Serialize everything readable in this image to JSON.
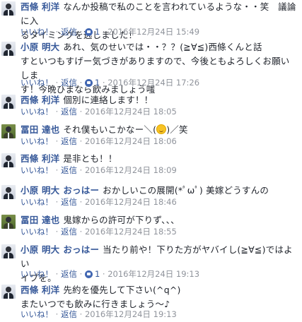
{
  "actions": {
    "like": "いいね！",
    "reply": "返信",
    "dot": "·"
  },
  "comments": [
    {
      "author": "西條 利洋",
      "line1": "なんか投稿で私のことを言われているような・・笑　議論に入",
      "line2": "るタイミングを逃しました！",
      "likes": "1",
      "date": "2016年12月24日 15:49"
    },
    {
      "author": "小原 明大",
      "line1": "あれ、気のせいでは・・？？(≧∀≦)西條くんと話",
      "line2": "すといつもすげー気づきがありますので、今後ともよろしくお願いしま",
      "line3": "す！今晩ひまなら飲みましょう嗤",
      "likes": "1",
      "date": "2016年12月24日 17:26"
    },
    {
      "author": "西條 利洋",
      "line1": "個別に連絡します！！",
      "date": "2016年12月24日 18:05"
    },
    {
      "author": "冨田 達也",
      "line1a": "それ僕もいこかなー＼(",
      "line1b": ")／笑",
      "emoji": "smile-emoji",
      "date": "2016年12月24日 18:06"
    },
    {
      "author": "西條 利洋",
      "line1": "是非とも！！",
      "date": "2016年12月24日 18:09"
    },
    {
      "author": "小原 明大",
      "mention": "おっはー",
      "line1": "おかしいこの展開(*ﾟωﾟ) 美嫁どうすんの",
      "date": "2016年12月24日 18:46"
    },
    {
      "author": "冨田 達也",
      "line1": "鬼嫁からの許可が下りず、、、",
      "date": "2016年12月24日 18:55"
    },
    {
      "author": "小原 明大",
      "mention": "おっはー",
      "line1": "当たり前や！下りた方がヤバイし(≧∀≦)ではよい",
      "line2": "イブを。",
      "likes": "1",
      "date": "2016年12月24日 19:13"
    },
    {
      "author": "西條 利洋",
      "line1": "先約を優先して下さい(^q^)",
      "line2": "またいつでも飲みに行きましょう〜♪",
      "date": "2016年12月24日 19:13"
    }
  ]
}
